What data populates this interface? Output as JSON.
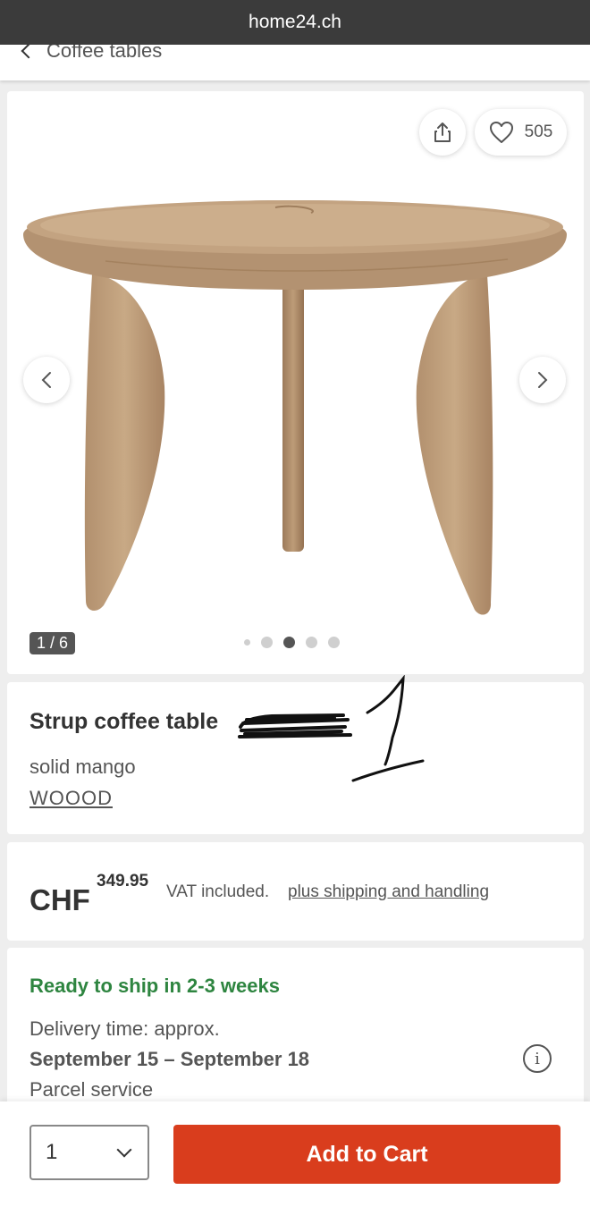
{
  "browser": {
    "url": "home24.ch"
  },
  "breadcrumb": {
    "label": "Coffee tables"
  },
  "gallery": {
    "favorite_count": "505",
    "counter": "1 / 6",
    "dots": 5,
    "active_dot": 2
  },
  "product": {
    "title": "Strup coffee table",
    "annotation": "1",
    "subtitle": "solid mango",
    "brand": "WOOOD"
  },
  "price": {
    "currency": "CHF",
    "amount": "349.95",
    "vat": "VAT included.",
    "shipping": "plus shipping and handling"
  },
  "delivery": {
    "status": "Ready to ship in 2-3 weeks",
    "time_label": "Delivery time: approx.",
    "dates": "September 15 – September 18",
    "method": "Parcel service"
  },
  "cart": {
    "quantity": "1",
    "button_label": "Add to Cart"
  },
  "colors": {
    "accent": "#d93d1d",
    "ready": "#2e8540",
    "urlbar": "#3b3b3b"
  }
}
